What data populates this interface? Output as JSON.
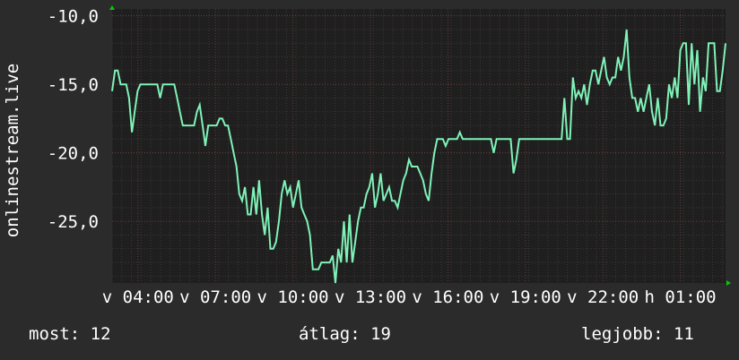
{
  "side_label": "onlinestream.live",
  "footer": {
    "current": "most: 12",
    "average": "átlag: 19",
    "best": "legjobb: 11"
  },
  "colors": {
    "background": "#2b2b2b",
    "plot_background": "#1f1f1f",
    "grid_major": "#6a3b3b",
    "grid_minor": "#3f3636",
    "line": "#7ff2b8",
    "text": "#ffffff",
    "axis_arrow": "#00cc00"
  },
  "chart_data": {
    "type": "line",
    "title": "",
    "xlabel": "",
    "ylabel": "onlinestream.live",
    "ylim": [
      -29.5,
      -9.5
    ],
    "xlim": [
      0,
      190
    ],
    "y_ticks": [
      -10,
      -15,
      -20,
      -25
    ],
    "y_tick_labels": [
      "-10,0",
      "-15,0",
      "-20,0",
      "-25,0"
    ],
    "x_ticks": [
      8,
      32,
      56,
      80,
      104,
      128,
      152,
      176
    ],
    "x_tick_labels": [
      "v 04:00",
      "v 07:00",
      "v 10:00",
      "v 13:00",
      "v 16:00",
      "v 19:00",
      "v 22:00",
      "h 01:00"
    ],
    "grid": true,
    "series": [
      {
        "values": [
          -15.5,
          -14,
          -14,
          -15,
          -15,
          -15,
          -16,
          -18.5,
          -17,
          -15.5,
          -15,
          -15,
          -15,
          -15,
          -15,
          -15,
          -15,
          -16,
          -15,
          -15,
          -15,
          -15,
          -15,
          -16,
          -17,
          -18,
          -18,
          -18,
          -18,
          -18,
          -17,
          -16.5,
          -18,
          -19.5,
          -18,
          -18,
          -18,
          -18,
          -17.5,
          -17.5,
          -18,
          -18,
          -19,
          -20,
          -21,
          -23,
          -23.5,
          -22.5,
          -24.5,
          -24.5,
          -22.5,
          -24.5,
          -22,
          -24.5,
          -26,
          -24,
          -27,
          -27,
          -26.5,
          -25,
          -23,
          -22,
          -23,
          -22.5,
          -24,
          -23,
          -22,
          -24,
          -24.5,
          -25,
          -26,
          -28.5,
          -28.5,
          -28.5,
          -28,
          -28,
          -28,
          -28,
          -27.5,
          -29.5,
          -27,
          -28,
          -25,
          -28,
          -24.5,
          -28,
          -26.5,
          -25,
          -24,
          -24,
          -23,
          -22.5,
          -21.5,
          -24,
          -23,
          -21.5,
          -23.5,
          -23,
          -22.5,
          -23.5,
          -23.5,
          -24,
          -23,
          -22,
          -21.5,
          -20.5,
          -21,
          -21,
          -21,
          -21.5,
          -22,
          -23,
          -23.5,
          -21.5,
          -20,
          -19,
          -19,
          -19,
          -19.5,
          -19,
          -19,
          -19,
          -19,
          -18.5,
          -19,
          -19,
          -19,
          -19,
          -19,
          -19,
          -19,
          -19,
          -19,
          -19,
          -19,
          -20,
          -19,
          -19,
          -19,
          -19,
          -19,
          -19,
          -21.5,
          -20.5,
          -19,
          -19,
          -19,
          -19,
          -19,
          -19,
          -19,
          -19,
          -19,
          -19,
          -19,
          -19,
          -19,
          -19,
          -19,
          -19,
          -16,
          -19,
          -19,
          -14.5,
          -16,
          -15.5,
          -16,
          -15,
          -16.5,
          -15,
          -14,
          -14,
          -15,
          -14,
          -13,
          -14.5,
          -15,
          -14.5,
          -14.5,
          -13,
          -14,
          -13,
          -11,
          -14.5,
          -16,
          -16,
          -17,
          -16,
          -17,
          -16,
          -15,
          -17,
          -18,
          -16,
          -18,
          -18,
          -17.5,
          -15,
          -16,
          -14.5,
          -16,
          -12.5,
          -12,
          -12,
          -16.5,
          -12,
          -15,
          -12.5,
          -17,
          -14.5,
          -15.5,
          -12,
          -12,
          -12,
          -15.5,
          -15.5,
          -14,
          -12
        ]
      }
    ]
  }
}
